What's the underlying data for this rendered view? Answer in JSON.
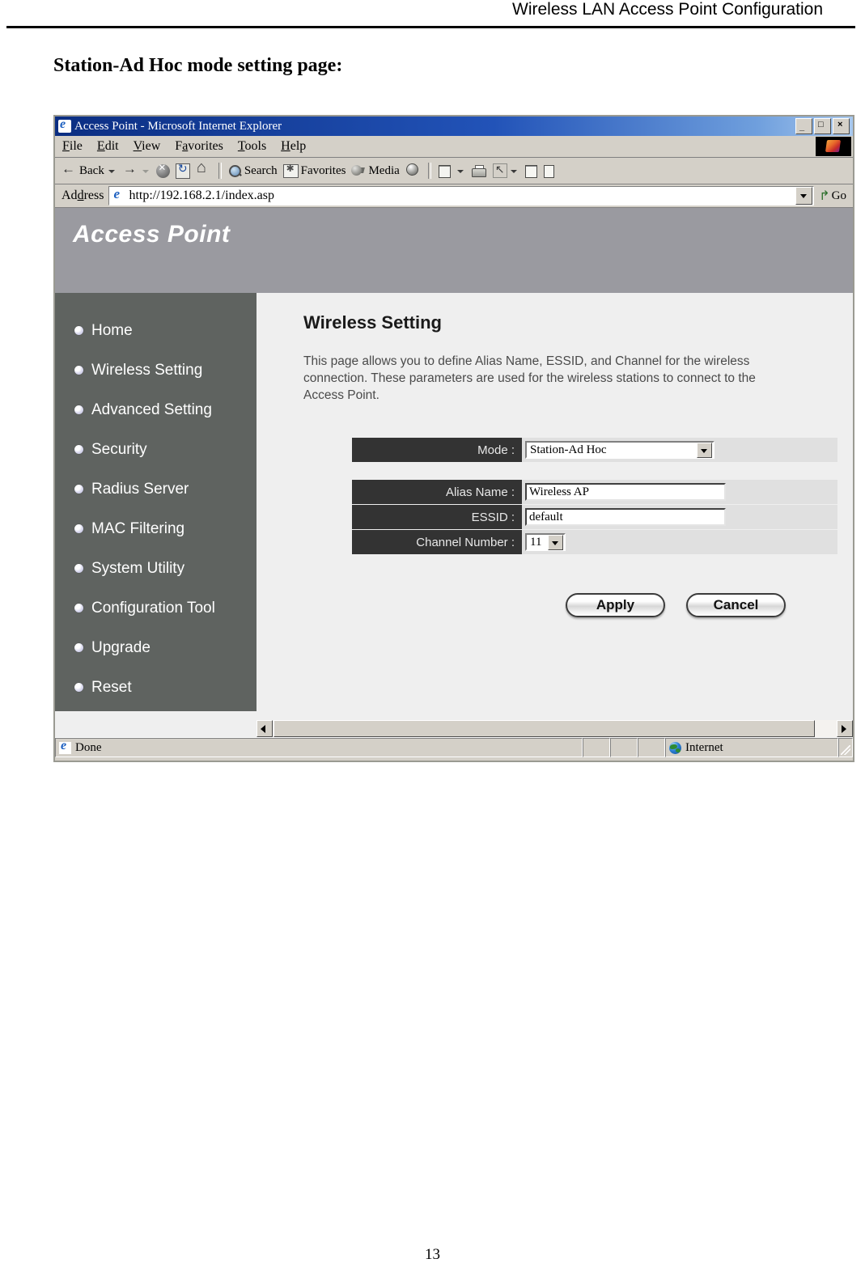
{
  "document": {
    "header_title": "Wireless LAN Access Point Configuration",
    "subtitle": "Station-Ad Hoc mode setting page:",
    "page_number": "13"
  },
  "browser": {
    "title": "Access Point - Microsoft Internet Explorer",
    "window_buttons": {
      "minimize": "_",
      "maximize": "□",
      "close": "×"
    },
    "menu": [
      {
        "label": "File",
        "accel": "F"
      },
      {
        "label": "Edit",
        "accel": "E"
      },
      {
        "label": "View",
        "accel": "V"
      },
      {
        "label": "Favorites",
        "accel": "a"
      },
      {
        "label": "Tools",
        "accel": "T"
      },
      {
        "label": "Help",
        "accel": "H"
      }
    ],
    "toolbar": {
      "back": "Back",
      "forward": "",
      "stop": "",
      "refresh": "",
      "home": "",
      "search": "Search",
      "favorites": "Favorites",
      "media": "Media",
      "history": "",
      "mail": "",
      "print": "",
      "edit": "",
      "discuss": "",
      "research": ""
    },
    "address": {
      "label": "Address",
      "url": "http://192.168.2.1/index.asp",
      "go_label": "Go",
      "go_arrow": "↱"
    },
    "statusbar": {
      "status": "Done",
      "zone": "Internet"
    }
  },
  "banner": {
    "title": "Access Point"
  },
  "sidebar": {
    "items": [
      {
        "label": "Home"
      },
      {
        "label": "Wireless Setting"
      },
      {
        "label": "Advanced Setting"
      },
      {
        "label": "Security"
      },
      {
        "label": "Radius Server"
      },
      {
        "label": "MAC Filtering"
      },
      {
        "label": "System Utility"
      },
      {
        "label": "Configuration Tool"
      },
      {
        "label": "Upgrade"
      },
      {
        "label": "Reset"
      }
    ]
  },
  "main": {
    "title": "Wireless Setting",
    "description": "This page allows you to define Alias Name, ESSID, and Channel for the wireless connection. These parameters are used for the wireless stations to connect to the Access Point.",
    "fields": {
      "mode": {
        "label": "Mode :",
        "value": "Station-Ad Hoc"
      },
      "alias_name": {
        "label": "Alias Name :",
        "value": "Wireless AP"
      },
      "essid": {
        "label": "ESSID :",
        "value": "default"
      },
      "channel_number": {
        "label": "Channel Number :",
        "value": "11"
      }
    },
    "buttons": {
      "apply": "Apply",
      "cancel": "Cancel"
    }
  },
  "colors": {
    "banner_bg": "#9a9aa0",
    "sidebar_bg": "#5f6360",
    "content_bg": "#efefef",
    "field_label_bg": "#333333",
    "field_row_bg": "#e0e0e0"
  }
}
